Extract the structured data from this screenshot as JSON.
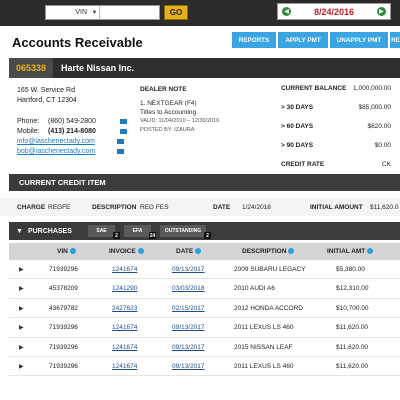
{
  "topbar": {
    "search_type": "VIN",
    "go_label": "GO",
    "date": "8/24/2016"
  },
  "header": {
    "title": "Accounts Receivable",
    "tabs": [
      "REPORTS",
      "APPLY PMT",
      "UNAPPLY PMT",
      "REPO"
    ]
  },
  "customer": {
    "id": "065338",
    "name": "Harte Nissan Inc.",
    "address_line1": "165 W. Service Rd",
    "address_line2": "Hartford, CT 12304",
    "phone_label": "Phone:",
    "phone": "(860) 549-2800",
    "mobile_label": "Mobile:",
    "mobile": "(413) 214-8080",
    "emails": [
      "info@iaschenectady.com",
      "bob@iaschenectady.com"
    ]
  },
  "dealer_note": {
    "heading": "DEALER NOTE",
    "line1": "1. NEXTGEAR (F4)",
    "line2": "Titles to Accounting",
    "valid": "VALID: 11/04/2010 – 12/30/2016",
    "posted": "POSTED BY: IZAURA"
  },
  "balances": [
    {
      "label": "CURRENT BALANCE",
      "value": "1,000,000.00"
    },
    {
      "label": "> 30 DAYS",
      "value": "$85,000.00"
    },
    {
      "label": "> 60 DAYS",
      "value": "$620.00"
    },
    {
      "label": "> 90 DAYS",
      "value": "$0.00"
    },
    {
      "label": "CREDIT RATE",
      "value": "CK"
    }
  ],
  "credit_item": {
    "title": "CURRENT CREDIT ITEM",
    "charge_label": "CHARGE",
    "charge": "REGFE",
    "description_label": "DESCRIPTION",
    "description": "REG FES",
    "date_label": "DATE",
    "date": "1/24/2018",
    "initial_label": "INITIAL AMOUNT",
    "initial": "$11,620.0"
  },
  "purchases": {
    "title": "PURCHASES",
    "chips": [
      {
        "label": "SAE",
        "count": "2"
      },
      {
        "label": "EFA",
        "count": "24"
      },
      {
        "label": "OUTSTANDING",
        "count": "2"
      }
    ],
    "columns": [
      "VIN",
      "INVOICE",
      "DATE",
      "DESCRIPTION",
      "INITIAL AMT"
    ],
    "rows": [
      {
        "vin": "71939296",
        "invoice": "1241674",
        "date": "09/13/2017",
        "description": "2009 SUBARU LEGACY",
        "amount": "$5,380.00"
      },
      {
        "vin": "45378209",
        "invoice": "1241290",
        "date": "03/03/2018",
        "description": "2010 AUDI A6",
        "amount": "$12,310.00"
      },
      {
        "vin": "43679782",
        "invoice": "2427623",
        "date": "02/15/2017",
        "description": "2012 HONDA ACCORD",
        "amount": "$10,700.00"
      },
      {
        "vin": "71939296",
        "invoice": "1241674",
        "date": "09/13/2017",
        "description": "2011 LEXUS LS 460",
        "amount": "$11,620.00"
      },
      {
        "vin": "71939296",
        "invoice": "1241674",
        "date": "09/13/2017",
        "description": "2015 NISSAN LEAF",
        "amount": "$11,620.00"
      },
      {
        "vin": "71939296",
        "invoice": "1241674",
        "date": "09/13/2017",
        "description": "2011 LEXUS LS 460",
        "amount": "$11,620.00"
      }
    ]
  }
}
